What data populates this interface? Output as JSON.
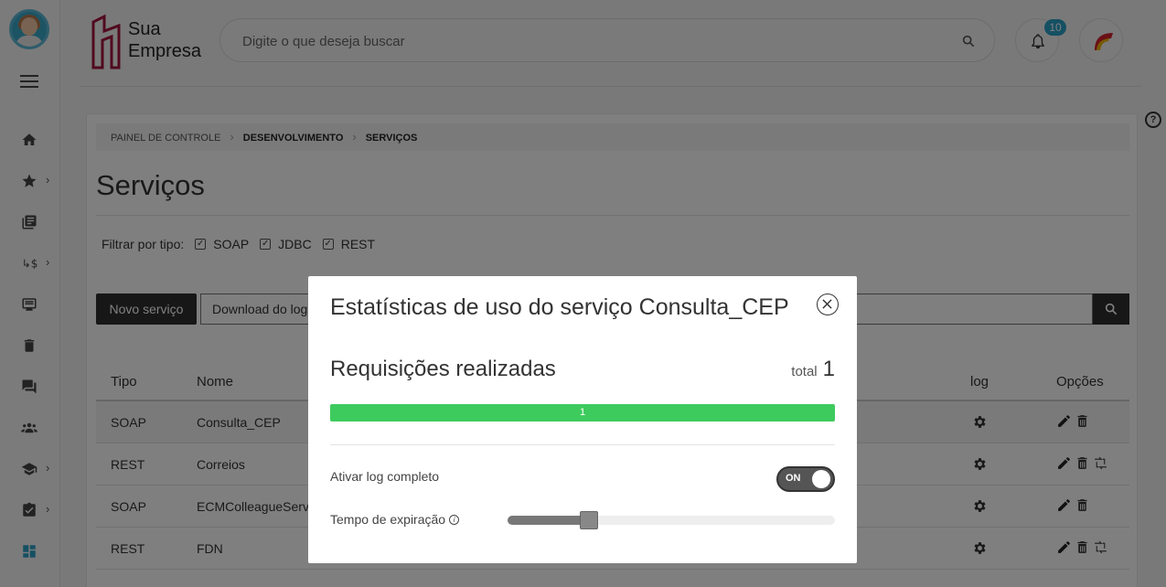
{
  "header": {
    "logo_text_line1": "Sua",
    "logo_text_line2": "Empresa",
    "search_placeholder": "Digite o que deseja buscar",
    "notifications_count": "10"
  },
  "sidebar": {
    "items": [
      {
        "icon": "home-icon"
      },
      {
        "icon": "star-icon",
        "has_submenu": true
      },
      {
        "icon": "library-icon"
      },
      {
        "icon": "currency-exchange-icon",
        "has_submenu": true
      },
      {
        "icon": "list-card-icon"
      },
      {
        "icon": "trash-icon"
      },
      {
        "icon": "chat-icon"
      },
      {
        "icon": "people-icon"
      },
      {
        "icon": "graduation-cap-icon",
        "has_submenu": true
      },
      {
        "icon": "clipboard-check-icon",
        "has_submenu": true
      },
      {
        "icon": "dashboard-icon",
        "active": true
      }
    ],
    "chevron": "›"
  },
  "breadcrumb": {
    "items": [
      "PAINEL DE CONTROLE",
      "DESENVOLVIMENTO",
      "SERVIÇOS"
    ],
    "separator": "›"
  },
  "page": {
    "title": "Serviços",
    "filter_label": "Filtrar por tipo:",
    "filters": [
      {
        "label": "SOAP",
        "checked": true
      },
      {
        "label": "JDBC",
        "checked": true
      },
      {
        "label": "REST",
        "checked": true
      }
    ],
    "new_button": "Novo serviço",
    "download_button": "Download do log"
  },
  "table": {
    "columns": [
      "Tipo",
      "Nome",
      "log",
      "Opções"
    ],
    "rows": [
      {
        "tipo": "SOAP",
        "nome": "Consulta_CEP",
        "selected": true,
        "options": [
          "edit",
          "delete"
        ]
      },
      {
        "tipo": "REST",
        "nome": "Correios",
        "options": [
          "edit",
          "delete",
          "sync"
        ]
      },
      {
        "tipo": "SOAP",
        "nome": "ECMColleagueService",
        "options": [
          "edit",
          "delete"
        ]
      },
      {
        "tipo": "REST",
        "nome": "FDN",
        "options": [
          "edit",
          "delete",
          "sync"
        ]
      }
    ]
  },
  "modal": {
    "title": "Estatísticas de uso do serviço Consulta_CEP",
    "requests_title": "Requisições realizadas",
    "total_label": "total",
    "total_value": "1",
    "progress_label": "1",
    "progress_fraction": 1.0,
    "log_label": "Ativar log completo",
    "toggle_label": "ON",
    "toggle_on": true,
    "expiration_label": "Tempo de expiração",
    "info_glyph": "i",
    "expiration_fraction": 0.22
  },
  "colors": {
    "accent": "#2aa1c7",
    "progress": "#3ecb5e",
    "dark_button": "#2e2e2e",
    "logo": "#a3153e"
  }
}
